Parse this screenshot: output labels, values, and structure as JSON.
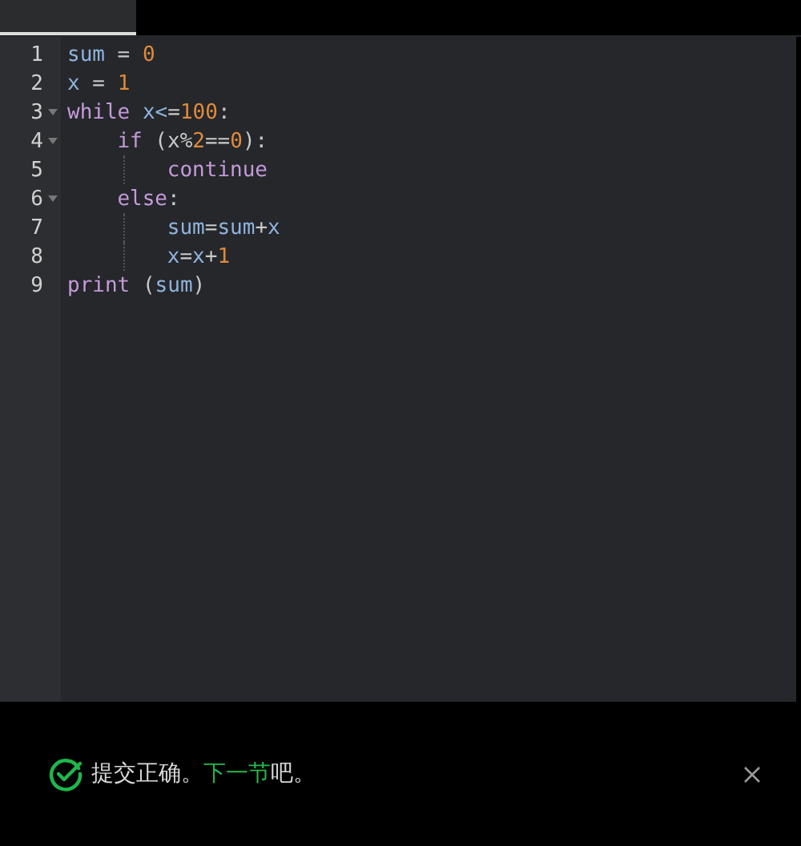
{
  "editor": {
    "lines": [
      {
        "number": "1",
        "tokens": [
          {
            "kind": "var",
            "text": "sum"
          },
          {
            "kind": "op",
            "text": " = "
          },
          {
            "kind": "num",
            "text": "0"
          }
        ]
      },
      {
        "number": "2",
        "tokens": [
          {
            "kind": "var",
            "text": "x"
          },
          {
            "kind": "op",
            "text": " = "
          },
          {
            "kind": "num",
            "text": "1"
          }
        ]
      },
      {
        "number": "3",
        "tokens": [
          {
            "kind": "kw",
            "text": "while"
          },
          {
            "kind": "var",
            "text": " x<"
          },
          {
            "kind": "op",
            "text": "="
          },
          {
            "kind": "num",
            "text": "100"
          },
          {
            "kind": "op",
            "text": ":"
          }
        ],
        "children": [
          {
            "number": "4",
            "tokens": [
              {
                "kind": "kw",
                "text": "if"
              },
              {
                "kind": "op",
                "text": " (x%"
              },
              {
                "kind": "num",
                "text": "2"
              },
              {
                "kind": "op",
                "text": "=="
              },
              {
                "kind": "num",
                "text": "0"
              },
              {
                "kind": "op",
                "text": "):"
              }
            ],
            "children": [
              {
                "number": "5",
                "tokens": [
                  {
                    "kind": "kw",
                    "text": "continue"
                  }
                ]
              }
            ]
          },
          {
            "number": "6",
            "tokens": [
              {
                "kind": "kw",
                "text": "else"
              },
              {
                "kind": "op",
                "text": ":"
              }
            ],
            "children": [
              {
                "number": "7",
                "tokens": [
                  {
                    "kind": "var",
                    "text": "sum"
                  },
                  {
                    "kind": "op",
                    "text": "="
                  },
                  {
                    "kind": "var",
                    "text": "sum"
                  },
                  {
                    "kind": "op",
                    "text": "+"
                  },
                  {
                    "kind": "var",
                    "text": "x"
                  }
                ]
              },
              {
                "number": "8",
                "tokens": [
                  {
                    "kind": "var",
                    "text": "x"
                  },
                  {
                    "kind": "op",
                    "text": "="
                  },
                  {
                    "kind": "var",
                    "text": "x"
                  },
                  {
                    "kind": "op",
                    "text": "+"
                  },
                  {
                    "kind": "num",
                    "text": "1"
                  }
                ]
              }
            ]
          }
        ]
      },
      {
        "number": "9",
        "tokens": [
          {
            "kind": "kw",
            "text": "print"
          },
          {
            "kind": "op",
            "text": " ("
          },
          {
            "kind": "var",
            "text": "sum"
          },
          {
            "kind": "op",
            "text": ")"
          }
        ]
      }
    ]
  },
  "toast": {
    "message": "提交正确。",
    "link": "下一节",
    "suffix": "吧。"
  }
}
